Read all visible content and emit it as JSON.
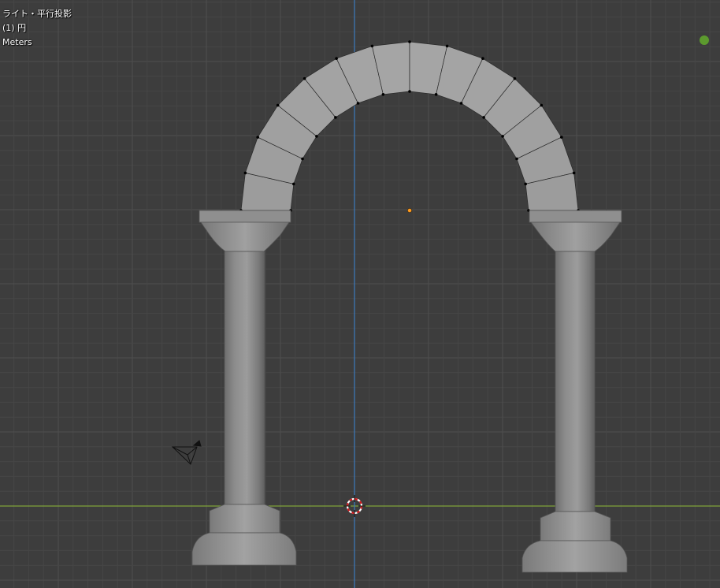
{
  "viewport": {
    "view_name": "ライト・平行投影",
    "object_name": "(1) 円",
    "units": "Meters"
  },
  "colors": {
    "background": "#3d3d3d",
    "grid_minor": "#464646",
    "grid_major": "#4f4f4f",
    "x_axis": "#7fa33a",
    "z_axis": "#3c76b5",
    "status_indicator": "#5c9a2e",
    "stone_face": "#a6a6a6",
    "stone_edge": "#2a2a2a",
    "column_shade_dark": "#6a6a6a",
    "column_shade_light": "#9e9e9e",
    "origin_point": "#ff9a1f"
  },
  "icons": {
    "status": "green-status-dot",
    "camera": "camera-wireframe-icon",
    "cursor": "3d-cursor-icon",
    "origin": "object-origin-icon"
  }
}
